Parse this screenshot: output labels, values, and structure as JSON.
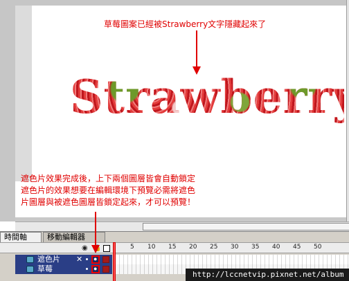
{
  "annotations": {
    "top_note": "草莓圖案已經被Strawberry文字隱藏起來了",
    "main_text": "Strawberry",
    "bottom_note_lines": [
      "遮色片效果完成後，上下兩個圖層皆會自動鎖定",
      "遮色片的效果想要在編輯環境下預覽必需將遮色",
      "片圖層與被遮色圖層皆鎖定起來，才可以預覽！"
    ],
    "accent_color": "#e00000"
  },
  "timeline": {
    "tabs": [
      "時間軸",
      "移動編輯器"
    ],
    "header_icons": [
      "eye-icon",
      "lock-icon",
      "outline-box-icon"
    ],
    "frame_numbers": [
      "5",
      "10",
      "15",
      "20",
      "25",
      "30",
      "35",
      "40",
      "45",
      "50"
    ],
    "layers": [
      {
        "name": "遮色片",
        "type": "mask-layer-icon",
        "locked": true
      },
      {
        "name": "草莓",
        "type": "masked-layer-icon",
        "locked": true
      }
    ]
  },
  "watermark": "http://lccnetvip.pixnet.net/album"
}
